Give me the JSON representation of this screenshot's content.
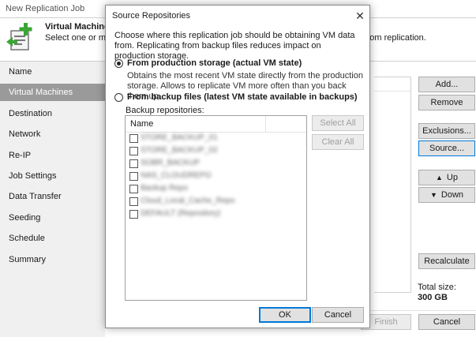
{
  "window": {
    "title": "New Replication Job",
    "header_title": "Virtual Machines",
    "header_desc": "Select one or mor",
    "header_desc_tail": "s from replication."
  },
  "sidebar": {
    "items": [
      {
        "label": "Name"
      },
      {
        "label": "Virtual Machines"
      },
      {
        "label": "Destination"
      },
      {
        "label": "Network"
      },
      {
        "label": "Re-IP"
      },
      {
        "label": "Job Settings"
      },
      {
        "label": "Data Transfer"
      },
      {
        "label": "Seeding"
      },
      {
        "label": "Schedule"
      },
      {
        "label": "Summary"
      }
    ],
    "active_index": 1
  },
  "right_buttons": {
    "add": "Add...",
    "remove": "Remove",
    "exclusions": "Exclusions...",
    "source": "Source...",
    "up": "Up",
    "down": "Down",
    "recalculate": "Recalculate"
  },
  "total": {
    "label": "Total size:",
    "value": "300 GB"
  },
  "footer": {
    "finish": "Finish",
    "cancel": "Cancel"
  },
  "dialog": {
    "title": "Source Repositories",
    "intro": "Choose where this replication job should be obtaining VM data from. Replicating from backup files reduces impact on production storage.",
    "option1": {
      "label": "From production storage (actual VM state)",
      "desc": "Obtains the most recent VM state directly from the production storage. Allows to replicate VM more often than you back them up.",
      "selected": true
    },
    "option2": {
      "label": "From backup files (latest VM state available in backups)",
      "selected": false
    },
    "backup_repos_label": "Backup repositories:",
    "table_header": "Name",
    "rows": [
      {
        "text": "STORE_BACKUP_01",
        "checked": false
      },
      {
        "text": "STORE_BACKUP_02",
        "checked": false
      },
      {
        "text": "SOBR_BACKUP",
        "checked": false
      },
      {
        "text": "NAS_CLOUDREPO",
        "checked": false
      },
      {
        "text": "Backup Repo",
        "checked": false
      },
      {
        "text": "Cloud_Local_Cache_Repo",
        "checked": false
      },
      {
        "text": "DEFAULT (Repository)",
        "checked": false
      }
    ],
    "select_all": "Select All",
    "clear_all": "Clear All",
    "ok": "OK",
    "cancel": "Cancel"
  }
}
